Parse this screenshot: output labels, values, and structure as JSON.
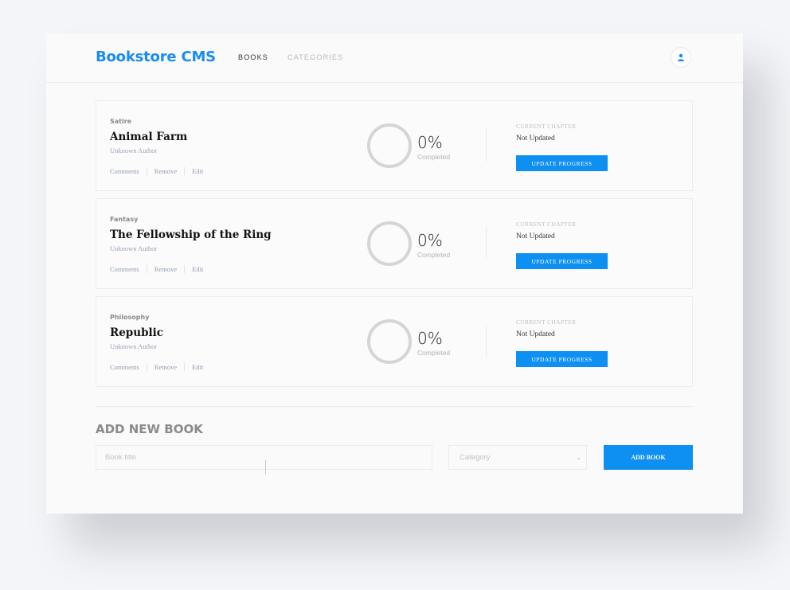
{
  "header": {
    "brand": "Bookstore CMS",
    "nav": [
      "BOOKS",
      "CATEGORIES"
    ],
    "user_icon": "user-icon"
  },
  "books": [
    {
      "genre": "Satire",
      "title": "Animal Farm",
      "author": "Unknown Author",
      "actions": [
        "Comments",
        "Remove",
        "Edit"
      ],
      "percent": "0%",
      "percent_label": "Completed",
      "chapter_label": "CURRENT CHAPTER",
      "chapter_value": "Not Updated",
      "update_label": "UPDATE PROGRESS"
    },
    {
      "genre": "Fantasy",
      "title": "The Fellowship of the Ring",
      "author": "Unknown Author",
      "actions": [
        "Comments",
        "Remove",
        "Edit"
      ],
      "percent": "0%",
      "percent_label": "Completed",
      "chapter_label": "CURRENT CHAPTER",
      "chapter_value": "Not Updated",
      "update_label": "UPDATE PROGRESS"
    },
    {
      "genre": "Philosophy",
      "title": "Republic",
      "author": "Unknown Author",
      "actions": [
        "Comments",
        "Remove",
        "Edit"
      ],
      "percent": "0%",
      "percent_label": "Completed",
      "chapter_label": "CURRENT CHAPTER",
      "chapter_value": "Not Updated",
      "update_label": "UPDATE PROGRESS"
    }
  ],
  "add_book": {
    "heading": "ADD NEW BOOK",
    "title_placeholder": "Book title",
    "category_placeholder": "Category",
    "submit_label": "ADD BOOK"
  },
  "colors": {
    "brand": "#1a8cf0",
    "button": "#0e8ff2"
  }
}
